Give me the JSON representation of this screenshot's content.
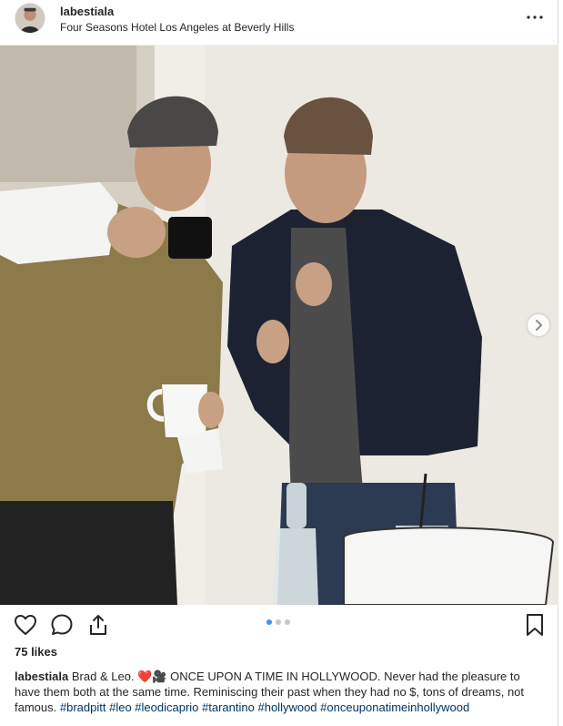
{
  "header": {
    "username": "labestiala",
    "location": "Four Seasons Hotel Los Angeles at Beverly Hills",
    "more_icon": "ellipsis-icon"
  },
  "photo": {
    "next_icon": "chevron-right-icon"
  },
  "actions": {
    "like_icon": "heart-outline-icon",
    "comment_icon": "comment-bubble-icon",
    "share_icon": "share-upload-icon",
    "save_icon": "bookmark-outline-icon",
    "carousel_pages": 3,
    "carousel_active_index": 0
  },
  "likes": "75 likes",
  "caption": {
    "username": "labestiala",
    "text": "Brad & Leo. ❤️🎥 ONCE UPON A TIME IN HOLLYWOOD. Never had the pleasure to have them both at the same time. Reminiscing their past when they had no $, tons of dreams, not famous.",
    "hashtags": [
      "#bradpitt",
      "#leo",
      "#leodicaprio",
      "#tarantino",
      "#hollywood",
      "#onceuponatimeinhollywood"
    ]
  },
  "colors": {
    "text": "#262626",
    "hashtag": "#003569",
    "dot_active": "#3897f0",
    "dot_inactive": "#c7c7c7",
    "border": "#dbdbdb"
  }
}
